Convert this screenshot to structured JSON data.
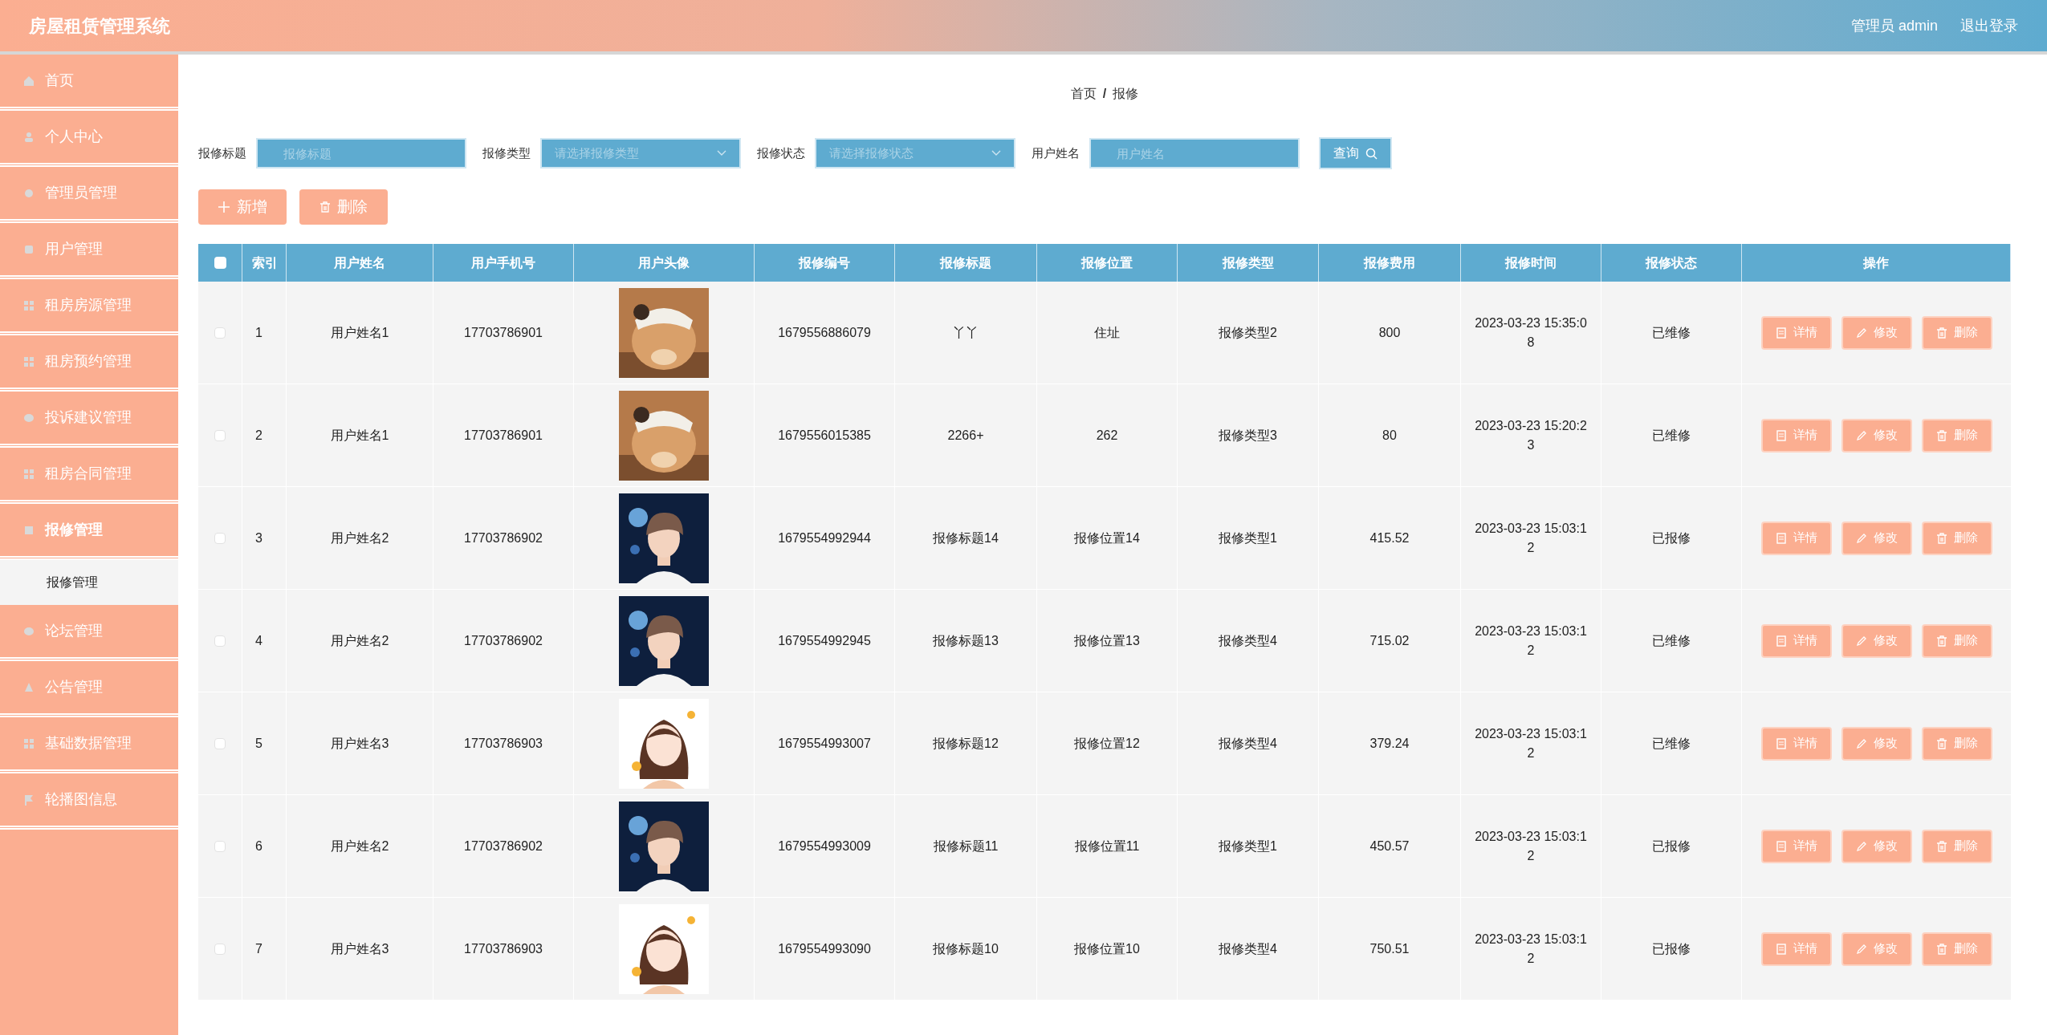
{
  "header": {
    "title": "房屋租赁管理系统",
    "user": "管理员 admin",
    "logout": "退出登录"
  },
  "sidebar": {
    "items": [
      {
        "label": "首页",
        "expanded": false
      },
      {
        "label": "个人中心",
        "expanded": false
      },
      {
        "label": "管理员管理",
        "expanded": false
      },
      {
        "label": "用户管理",
        "expanded": false
      },
      {
        "label": "租房房源管理",
        "expanded": false
      },
      {
        "label": "租房预约管理",
        "expanded": false
      },
      {
        "label": "投诉建议管理",
        "expanded": false
      },
      {
        "label": "租房合同管理",
        "expanded": false
      },
      {
        "label": "报修管理",
        "expanded": true,
        "children": [
          {
            "label": "报修管理",
            "selected": true
          }
        ]
      },
      {
        "label": "论坛管理",
        "expanded": false
      },
      {
        "label": "公告管理",
        "expanded": false
      },
      {
        "label": "基础数据管理",
        "expanded": false
      },
      {
        "label": "轮播图信息",
        "expanded": false
      }
    ]
  },
  "breadcrumb": [
    "首页",
    "/",
    "报修"
  ],
  "search": {
    "fields": [
      {
        "label": "报修标题",
        "placeholder": "报修标题",
        "kind": "text"
      },
      {
        "label": "报修类型",
        "placeholder": "请选择报修类型",
        "kind": "select"
      },
      {
        "label": "报修状态",
        "placeholder": "请选择报修状态",
        "kind": "select"
      },
      {
        "label": "用户姓名",
        "placeholder": "用户姓名",
        "kind": "text"
      }
    ],
    "button": "查询"
  },
  "toolbar": [
    {
      "label": "新增",
      "kind": "add"
    },
    {
      "label": "删除",
      "kind": "delete"
    }
  ],
  "table": {
    "all_checked": false,
    "columns": [
      "索引",
      "用户姓名",
      "用户手机号",
      "用户头像",
      "报修编号",
      "报修标题",
      "报修位置",
      "报修类型",
      "报修费用",
      "报修时间",
      "报修状态",
      "操作"
    ],
    "rows": [
      {
        "checked": false,
        "cells": [
          "1",
          "用户姓名1",
          "17703786901",
          {
            "kind": "picture"
          },
          "1679556886079",
          "丫丫",
          "住址",
          "报修类型2",
          "800",
          "2023-03-23 15:35:08",
          "已维修"
        ],
        "actions": [
          {
            "label": "详情",
            "kind": "detail"
          },
          {
            "label": "修改",
            "kind": "edit"
          },
          {
            "label": "删除",
            "kind": "delete"
          }
        ]
      },
      {
        "checked": false,
        "cells": [
          "2",
          "用户姓名1",
          "17703786901",
          {
            "kind": "picture"
          },
          "1679556015385",
          "2266+",
          "262",
          "报修类型3",
          "80",
          "2023-03-23 15:20:23",
          "已维修"
        ],
        "actions": [
          {
            "label": "详情",
            "kind": "detail"
          },
          {
            "label": "修改",
            "kind": "edit"
          },
          {
            "label": "删除",
            "kind": "delete"
          }
        ]
      },
      {
        "checked": false,
        "cells": [
          "3",
          "用户姓名2",
          "17703786902",
          {
            "kind": "picture"
          },
          "1679554992944",
          "报修标题14",
          "报修位置14",
          "报修类型1",
          "415.52",
          "2023-03-23 15:03:12",
          "已报修"
        ],
        "actions": [
          {
            "label": "详情",
            "kind": "detail"
          },
          {
            "label": "修改",
            "kind": "edit"
          },
          {
            "label": "删除",
            "kind": "delete"
          }
        ]
      },
      {
        "checked": false,
        "cells": [
          "4",
          "用户姓名2",
          "17703786902",
          {
            "kind": "picture"
          },
          "1679554992945",
          "报修标题13",
          "报修位置13",
          "报修类型4",
          "715.02",
          "2023-03-23 15:03:12",
          "已维修"
        ],
        "actions": [
          {
            "label": "详情",
            "kind": "detail"
          },
          {
            "label": "修改",
            "kind": "edit"
          },
          {
            "label": "删除",
            "kind": "delete"
          }
        ]
      },
      {
        "checked": false,
        "cells": [
          "5",
          "用户姓名3",
          "17703786903",
          {
            "kind": "picture"
          },
          "1679554993007",
          "报修标题12",
          "报修位置12",
          "报修类型4",
          "379.24",
          "2023-03-23 15:03:12",
          "已维修"
        ],
        "actions": [
          {
            "label": "详情",
            "kind": "detail"
          },
          {
            "label": "修改",
            "kind": "edit"
          },
          {
            "label": "删除",
            "kind": "delete"
          }
        ]
      },
      {
        "checked": false,
        "cells": [
          "6",
          "用户姓名2",
          "17703786902",
          {
            "kind": "picture"
          },
          "1679554993009",
          "报修标题11",
          "报修位置11",
          "报修类型1",
          "450.57",
          "2023-03-23 15:03:12",
          "已报修"
        ],
        "actions": [
          {
            "label": "详情",
            "kind": "detail"
          },
          {
            "label": "修改",
            "kind": "edit"
          },
          {
            "label": "删除",
            "kind": "delete"
          }
        ]
      },
      {
        "checked": false,
        "cells": [
          "7",
          "用户姓名3",
          "17703786903",
          {
            "kind": "picture"
          },
          "1679554993090",
          "报修标题10",
          "报修位置10",
          "报修类型4",
          "750.51",
          "2023-03-23 15:03:12",
          "已报修"
        ],
        "actions": [
          {
            "label": "详情",
            "kind": "detail"
          },
          {
            "label": "修改",
            "kind": "edit"
          },
          {
            "label": "删除",
            "kind": "delete"
          }
        ]
      }
    ]
  }
}
